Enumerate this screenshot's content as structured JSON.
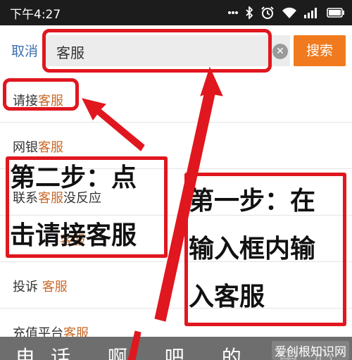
{
  "status_bar": {
    "time": "下午4:27",
    "icons": [
      "dots-icon",
      "bluetooth-icon",
      "alarm-icon",
      "wifi-icon",
      "signal-icon",
      "battery-icon"
    ]
  },
  "search": {
    "cancel_label": "取消",
    "value": "客服",
    "button_label": "搜索"
  },
  "suggestions": [
    {
      "prefix": "请接",
      "keyword": "客服",
      "suffix": ""
    },
    {
      "prefix": "网银",
      "keyword": "客服",
      "suffix": ""
    },
    {
      "prefix": "联系",
      "keyword": "客服",
      "suffix": "没反应"
    },
    {
      "prefix": "",
      "keyword": "客服",
      "suffix": ""
    },
    {
      "prefix": "投诉 ",
      "keyword": "客服",
      "suffix": ""
    },
    {
      "prefix": "充值平台",
      "keyword": "客服",
      "suffix": ""
    }
  ],
  "annotations": {
    "step2_line1": "第二步：点",
    "step2_line2": "击请接客服",
    "step1_line1": "第一步：在",
    "step1_line2": "输入框内输",
    "step1_line3": "入客服",
    "accent_color": "#e0171f"
  },
  "bottom_bar": {
    "text": "电话 啊 吧 的 中心",
    "watermark": "爱创根知识网"
  }
}
